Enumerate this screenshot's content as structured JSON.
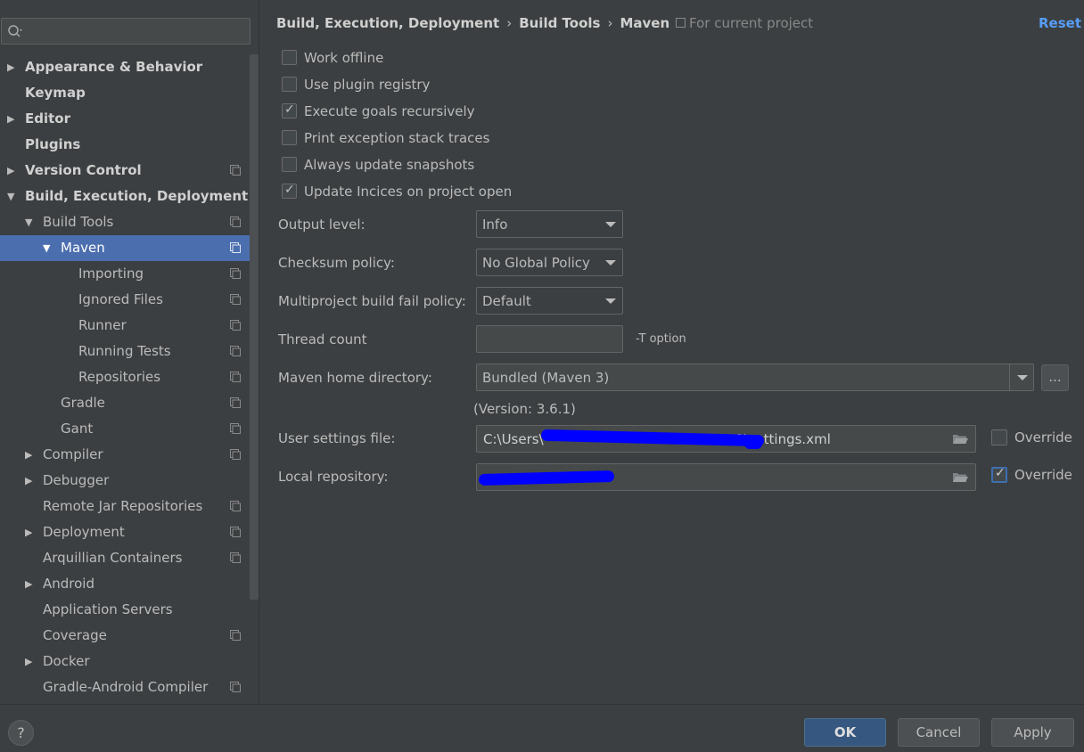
{
  "search": {
    "placeholder": ""
  },
  "sidebar": {
    "items": [
      {
        "label": "Appearance & Behavior",
        "arrow": "▶",
        "bold": true,
        "level": 0,
        "project": false
      },
      {
        "label": "Keymap",
        "arrow": "",
        "bold": true,
        "level": 0,
        "project": false
      },
      {
        "label": "Editor",
        "arrow": "▶",
        "bold": true,
        "level": 0,
        "project": false
      },
      {
        "label": "Plugins",
        "arrow": "",
        "bold": true,
        "level": 0,
        "project": false
      },
      {
        "label": "Version Control",
        "arrow": "▶",
        "bold": true,
        "level": 0,
        "project": true
      },
      {
        "label": "Build, Execution, Deployment",
        "arrow": "▼",
        "bold": true,
        "level": 0,
        "project": false
      },
      {
        "label": "Build Tools",
        "arrow": "▼",
        "bold": false,
        "level": 1,
        "project": true
      },
      {
        "label": "Maven",
        "arrow": "▼",
        "bold": false,
        "level": 2,
        "project": true,
        "selected": true
      },
      {
        "label": "Importing",
        "arrow": "",
        "bold": false,
        "level": 3,
        "project": true
      },
      {
        "label": "Ignored Files",
        "arrow": "",
        "bold": false,
        "level": 3,
        "project": true
      },
      {
        "label": "Runner",
        "arrow": "",
        "bold": false,
        "level": 3,
        "project": true
      },
      {
        "label": "Running Tests",
        "arrow": "",
        "bold": false,
        "level": 3,
        "project": true
      },
      {
        "label": "Repositories",
        "arrow": "",
        "bold": false,
        "level": 3,
        "project": true
      },
      {
        "label": "Gradle",
        "arrow": "",
        "bold": false,
        "level": 2,
        "project": true
      },
      {
        "label": "Gant",
        "arrow": "",
        "bold": false,
        "level": 2,
        "project": true
      },
      {
        "label": "Compiler",
        "arrow": "▶",
        "bold": false,
        "level": 1,
        "project": true
      },
      {
        "label": "Debugger",
        "arrow": "▶",
        "bold": false,
        "level": 1,
        "project": false
      },
      {
        "label": "Remote Jar Repositories",
        "arrow": "",
        "bold": false,
        "level": 1,
        "project": true
      },
      {
        "label": "Deployment",
        "arrow": "▶",
        "bold": false,
        "level": 1,
        "project": true
      },
      {
        "label": "Arquillian Containers",
        "arrow": "",
        "bold": false,
        "level": 1,
        "project": true
      },
      {
        "label": "Android",
        "arrow": "▶",
        "bold": false,
        "level": 1,
        "project": false
      },
      {
        "label": "Application Servers",
        "arrow": "",
        "bold": false,
        "level": 1,
        "project": false
      },
      {
        "label": "Coverage",
        "arrow": "",
        "bold": false,
        "level": 1,
        "project": true
      },
      {
        "label": "Docker",
        "arrow": "▶",
        "bold": false,
        "level": 1,
        "project": false
      },
      {
        "label": "Gradle-Android Compiler",
        "arrow": "",
        "bold": false,
        "level": 1,
        "project": true
      }
    ]
  },
  "breadcrumb": {
    "part1": "Build, Execution, Deployment",
    "sep": "›",
    "part2": "Build Tools",
    "part3": "Maven"
  },
  "for_project": "For current project",
  "reset": "Reset",
  "checkboxes": [
    {
      "label": "Work offline",
      "checked": false
    },
    {
      "label": "Use plugin registry",
      "checked": false
    },
    {
      "label": "Execute goals recursively",
      "checked": true
    },
    {
      "label": "Print exception stack traces",
      "checked": false
    },
    {
      "label": "Always update snapshots",
      "checked": false
    },
    {
      "label": "Update Incices on project open",
      "checked": true
    }
  ],
  "form": {
    "output_level": {
      "label": "Output level:",
      "value": "Info"
    },
    "checksum_policy": {
      "label": "Checksum policy:",
      "value": "No Global Policy"
    },
    "fail_policy": {
      "label": "Multiproject build fail policy:",
      "value": "Default"
    },
    "thread_count": {
      "label": "Thread count",
      "value": "",
      "hint": "-T option"
    },
    "maven_home": {
      "label": "Maven home directory:",
      "value": "Bundled (Maven 3)",
      "browse": "...",
      "version": "(Version: 3.6.1)"
    },
    "user_settings": {
      "label": "User settings file:",
      "value_prefix": "C:\\Users\\",
      "value_suffix": ".m2\\settings.xml",
      "override_label": "Override",
      "override_checked": false
    },
    "local_repo": {
      "label": "Local repository:",
      "value": "",
      "override_label": "Override",
      "override_checked": true
    }
  },
  "footer": {
    "help": "?",
    "ok": "OK",
    "cancel": "Cancel",
    "apply": "Apply"
  },
  "colors": {
    "background": "#3c3f41",
    "selection": "#4b6eaf",
    "link": "#589df6",
    "ok_button": "#365880",
    "redaction": "#0000ff"
  }
}
